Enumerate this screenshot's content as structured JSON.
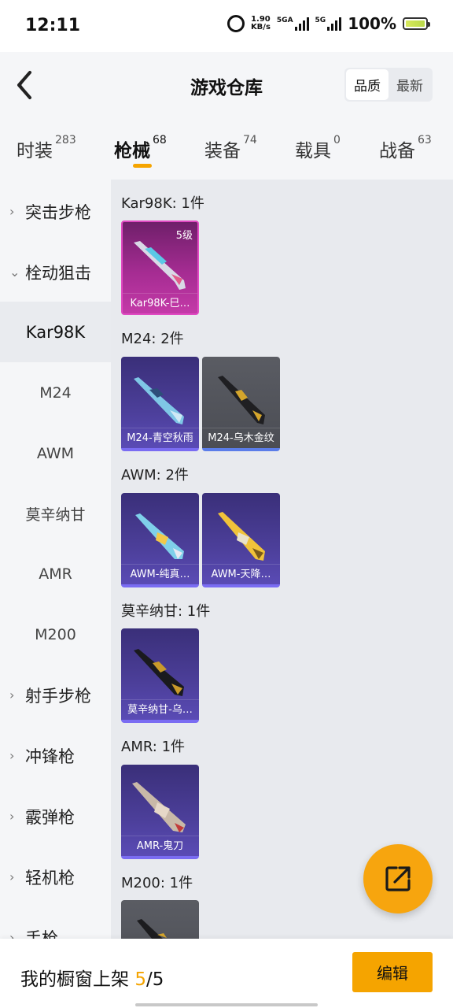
{
  "status_bar": {
    "time": "12:11",
    "net_speed_value": "1.90",
    "net_speed_unit": "KB/s",
    "sim1_label": "5GA",
    "sim2_label": "5G",
    "battery": "100%"
  },
  "header": {
    "title": "游戏仓库",
    "sort_options": [
      "品质",
      "最新"
    ],
    "sort_active": "品质"
  },
  "tabs": [
    {
      "label": "时装",
      "count": "283"
    },
    {
      "label": "枪械",
      "count": "68",
      "active": true
    },
    {
      "label": "装备",
      "count": "74"
    },
    {
      "label": "载具",
      "count": "0"
    },
    {
      "label": "战备",
      "count": "63"
    }
  ],
  "sidebar": {
    "items": [
      {
        "label": "突击步枪",
        "chevron": "›"
      },
      {
        "label": "栓动狙击",
        "chevron": "⌄"
      },
      {
        "label": "Kar98K",
        "selected": true
      },
      {
        "label": "M24"
      },
      {
        "label": "AWM"
      },
      {
        "label": "莫辛纳甘"
      },
      {
        "label": "AMR"
      },
      {
        "label": "M200"
      },
      {
        "label": "射手步枪",
        "chevron": "›"
      },
      {
        "label": "冲锋枪",
        "chevron": "›"
      },
      {
        "label": "霰弹枪",
        "chevron": "›"
      },
      {
        "label": "轻机枪",
        "chevron": "›"
      },
      {
        "label": "手枪",
        "chevron": "›"
      }
    ]
  },
  "groups": [
    {
      "title": "Kar98K: 1件",
      "items": [
        {
          "label": "Kar98K-巳…",
          "level": "5级",
          "style": "pink"
        }
      ]
    },
    {
      "title": "M24: 2件",
      "items": [
        {
          "label": "M24-青空秋雨",
          "style": "purple"
        },
        {
          "label": "M24-乌木金纹",
          "style": "gray"
        }
      ]
    },
    {
      "title": "AWM: 2件",
      "items": [
        {
          "label": "AWM-纯真…",
          "style": "purple"
        },
        {
          "label": "AWM-天降…",
          "style": "purple"
        }
      ]
    },
    {
      "title": "莫辛纳甘: 1件",
      "items": [
        {
          "label": "莫辛纳甘-乌…",
          "style": "purple"
        }
      ]
    },
    {
      "title": "AMR: 1件",
      "items": [
        {
          "label": "AMR-鬼刀",
          "style": "purple"
        }
      ]
    },
    {
      "title": "M200: 1件",
      "items": [
        {
          "label": "",
          "style": "gray"
        }
      ]
    }
  ],
  "bottom_bar": {
    "text_prefix": "我的橱窗上架",
    "count_highlight": "5",
    "count_total": "/5",
    "edit_label": "编辑"
  },
  "icons": {
    "back": "chevron-left-icon",
    "fab": "share-out-icon",
    "alarm": "alarm-icon"
  },
  "colors": {
    "accent": "#f5a400",
    "card_purple": "#4c3f9a",
    "card_pink": "#a52c92",
    "card_gray": "#4f5158"
  }
}
